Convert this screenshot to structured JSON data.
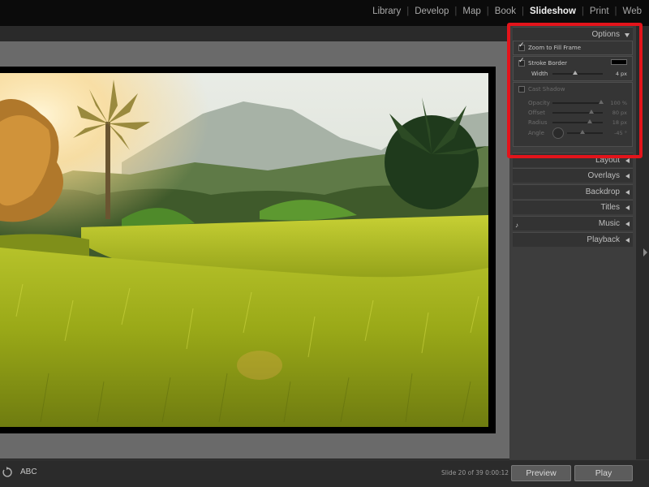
{
  "modules": [
    "Library",
    "Develop",
    "Map",
    "Book",
    "Slideshow",
    "Print",
    "Web"
  ],
  "active_module": "Slideshow",
  "options": {
    "header": "Options",
    "zoom_to_fill": "Zoom to Fill Frame",
    "stroke_border": "Stroke Border",
    "width_label": "Width",
    "width_value": "4 px",
    "cast_shadow": "Cast Shadow",
    "opacity_label": "Opacity",
    "opacity_value": "100 %",
    "offset_label": "Offset",
    "offset_value": "80 px",
    "radius_label": "Radius",
    "radius_value": "18 px",
    "angle_label": "Angle",
    "angle_value": "-45 °"
  },
  "panels": [
    "Layout",
    "Overlays",
    "Backdrop",
    "Titles",
    "Music",
    "Playback"
  ],
  "toolbar": {
    "abc_label": "ABC",
    "slide_status": "Slide 20 of 39 0:00:12",
    "preview": "Preview",
    "play": "Play"
  },
  "colors": {
    "highlight": "#e3141b",
    "stroke_color": "#000000"
  }
}
